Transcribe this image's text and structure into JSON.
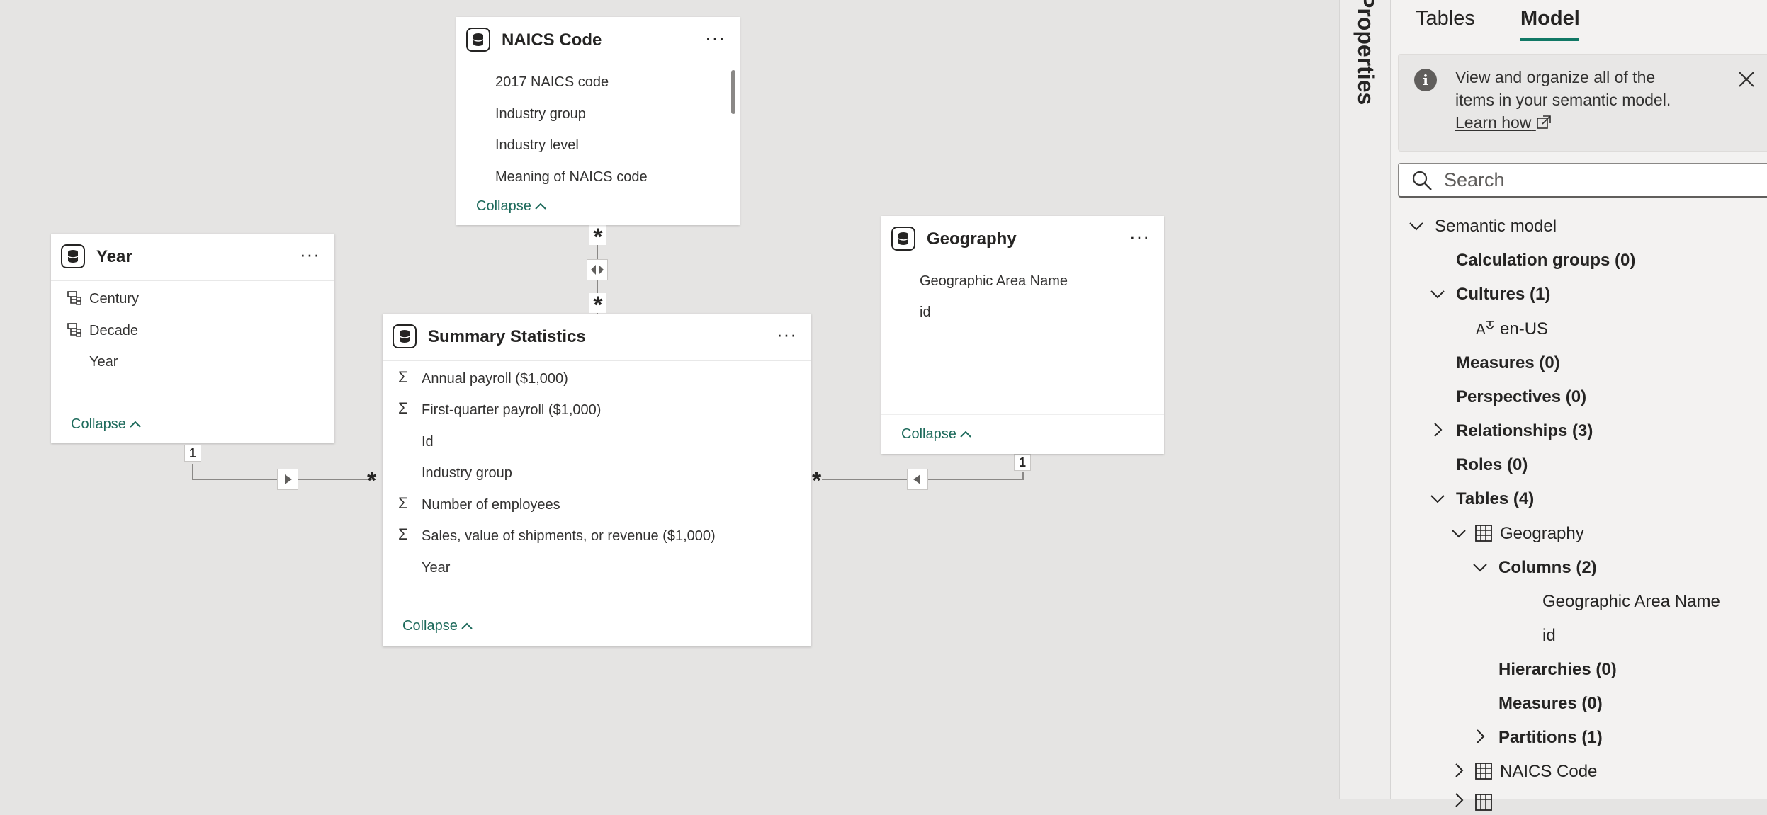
{
  "canvas": {
    "tables": {
      "naics": {
        "title": "NAICS Code",
        "fields": [
          "2017 NAICS code",
          "Industry group",
          "Industry level",
          "Meaning of NAICS code"
        ],
        "collapse": "Collapse"
      },
      "year": {
        "title": "Year",
        "fields": [
          "Century",
          "Decade",
          "Year"
        ],
        "collapse": "Collapse"
      },
      "summary": {
        "title": "Summary Statistics",
        "fields": [
          "Annual payroll ($1,000)",
          "First-quarter payroll ($1,000)",
          "Id",
          "Industry group",
          "Number of employees",
          "Sales, value of shipments, or revenue ($1,000)",
          "Year"
        ],
        "collapse": "Collapse"
      },
      "geography": {
        "title": "Geography",
        "fields": [
          "Geographic Area Name",
          "id"
        ],
        "collapse": "Collapse"
      }
    },
    "relationships": {
      "one": "1",
      "many": "*",
      "more": "···"
    }
  },
  "panel": {
    "properties_label": "Properties",
    "tabs": {
      "tables": "Tables",
      "model": "Model"
    },
    "info": {
      "text": "View and organize all of the items in your semantic model.",
      "link": "Learn how"
    },
    "search_placeholder": "Search",
    "tree": {
      "semantic_model": "Semantic model",
      "calculation_groups": "Calculation groups (0)",
      "cultures": "Cultures (1)",
      "culture_en": "en-US",
      "measures": "Measures (0)",
      "perspectives": "Perspectives (0)",
      "relationships": "Relationships (3)",
      "roles": "Roles (0)",
      "tables": "Tables (4)",
      "geography": "Geography",
      "columns": "Columns (2)",
      "col_geo_name": "Geographic Area Name",
      "col_id": "id",
      "hierarchies": "Hierarchies (0)",
      "geo_measures": "Measures (0)",
      "partitions": "Partitions (1)",
      "naics": "NAICS Code"
    }
  },
  "colors": {
    "accent": "#117865",
    "link": "#1d6a5b",
    "canvas": "#e5e4e3"
  }
}
